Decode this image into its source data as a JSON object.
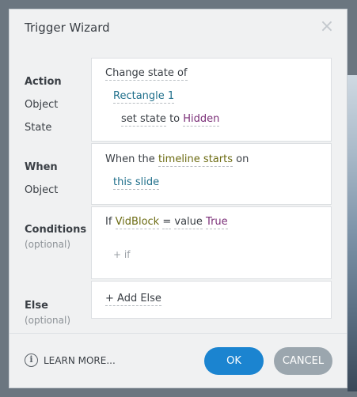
{
  "dialog": {
    "title": "Trigger Wizard",
    "close_icon": "×"
  },
  "action": {
    "labels": {
      "action": "Action",
      "object": "Object",
      "state": "State"
    },
    "verb": "Change state of",
    "object": "Rectangle 1",
    "state_prefix": "set state",
    "state_to": "to",
    "state_value": "Hidden"
  },
  "when": {
    "labels": {
      "when": "When",
      "object": "Object"
    },
    "prefix": "When the",
    "event": "timeline starts",
    "suffix": "on",
    "object": "this slide"
  },
  "conditions": {
    "label": "Conditions",
    "optional": "(optional)",
    "if_word": "If",
    "variable": "VidBlock",
    "operator": "=",
    "value_type": "value",
    "value": "True",
    "add_if": "+ if"
  },
  "else": {
    "label": "Else",
    "optional": "(optional)",
    "add_else": "+ Add Else"
  },
  "footer": {
    "learn_more": "LEARN MORE...",
    "info_icon": "i",
    "ok": "OK",
    "cancel": "CANCEL"
  }
}
